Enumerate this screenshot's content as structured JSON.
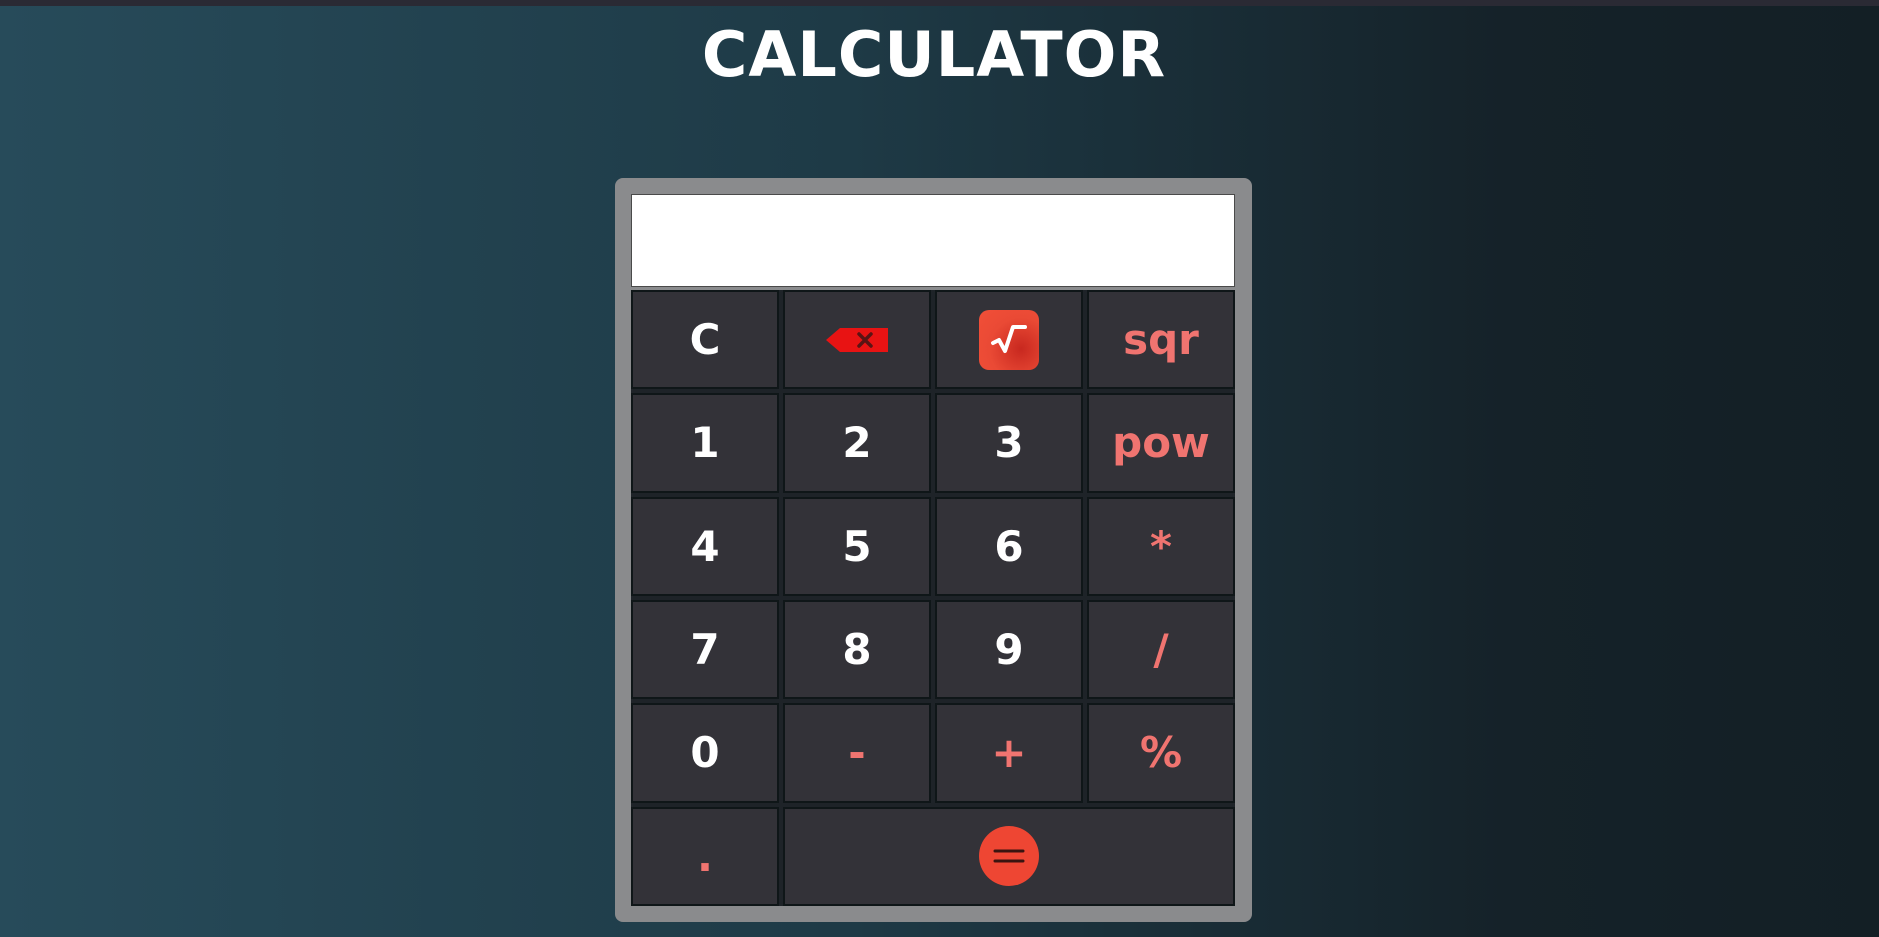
{
  "app": {
    "title": "CALCULATOR"
  },
  "display": {
    "value": ""
  },
  "colors": {
    "key_bg": "#333238",
    "operator_text": "#f07470",
    "accent_red": "#ee4633",
    "panel": "#8a8b8d"
  },
  "keys": {
    "clear": "C",
    "backspace_icon": "backspace-icon",
    "sqrt_icon": "square-root-icon",
    "sqr": "sqr",
    "one": "1",
    "two": "2",
    "three": "3",
    "pow": "pow",
    "four": "4",
    "five": "5",
    "six": "6",
    "multiply": "*",
    "seven": "7",
    "eight": "8",
    "nine": "9",
    "divide": "/",
    "zero": "0",
    "minus": "-",
    "plus": "+",
    "percent": "%",
    "decimal": ".",
    "equals_icon": "equals-icon"
  }
}
